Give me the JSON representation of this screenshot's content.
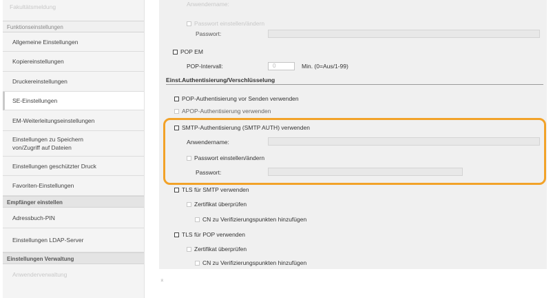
{
  "sidebar": {
    "top_faded": "Fakultätsmeldung",
    "sections": [
      {
        "label": "Funktionseinstellungen"
      },
      {
        "label": "Empfänger einstellen"
      },
      {
        "label": "Einstellungen Verwaltung"
      }
    ],
    "items": [
      {
        "label": "Allgemeine Einstellungen"
      },
      {
        "label": "Kopiereinstellungen"
      },
      {
        "label": "Druckereinstellungen"
      },
      {
        "label": "SE-Einstellungen"
      },
      {
        "label": "EM-Weiterleitungseinstellungen"
      },
      {
        "label": "Einstellungen zu Speichern von/Zugriff auf Dateien"
      },
      {
        "label": "Einstellungen geschützter Druck"
      },
      {
        "label": "Favoriten-Einstellungen"
      },
      {
        "label": "Adressbuch-PIN"
      },
      {
        "label": "Einstellungen LDAP-Server"
      },
      {
        "label": "Anwenderverwaltung"
      }
    ]
  },
  "main": {
    "top_faded_label": "Anwendername:",
    "faded_pw_change": "Passwort einstellen/ändern",
    "faded_pw_label": "Passwort:",
    "pop_em_label": "POP EM",
    "pop_interval_label": "POP-Intervall:",
    "pop_interval_value": "0",
    "pop_interval_unit": "Min. (0=Aus/1-99)",
    "auth_heading": "Einst.Authentisierung/Verschlüsselung",
    "pop_auth_label": "POP-Authentisierung vor Senden verwenden",
    "apop_label": "APOP-Authentisierung verwenden",
    "smtp_auth_label": "SMTP-Authentisierung (SMTP AUTH) verwenden",
    "username_label": "Anwendername:",
    "pw_change_label": "Passwort einstellen/ändern",
    "pw_label": "Passwort:",
    "tls_smtp_label": "TLS für SMTP verwenden",
    "verify_cert_label": "Zertifikat überprüfen",
    "cn_label": "CN zu Verifizierungspunkten hinzufügen",
    "tls_pop_label": "TLS für POP verwenden",
    "verify_cert_label2": "Zertifikat überprüfen",
    "cn_label2": "CN zu Verifizierungspunkten hinzufügen"
  },
  "footer": {
    "top_icon": "⌅"
  },
  "colors": {
    "highlight": "#f2a228"
  }
}
